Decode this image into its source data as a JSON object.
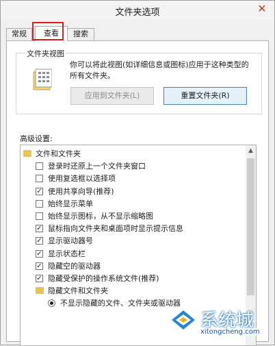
{
  "window": {
    "title": "文件夹选项",
    "close_symbol": "✕"
  },
  "tabs": [
    {
      "label": "常规",
      "selected": false
    },
    {
      "label": "查看",
      "selected": true
    },
    {
      "label": "搜索",
      "selected": false
    }
  ],
  "folder_view": {
    "group_label": "文件夹视图",
    "description": "你可以将此视图(如详细信息或图标)应用于这种类型的所有文件夹。",
    "apply_button": "应用到文件夹(L)",
    "reset_button": "重置文件夹(R)"
  },
  "advanced": {
    "label": "高级设置:",
    "items": [
      {
        "kind": "folder",
        "label": "文件和文件夹",
        "indent": 0
      },
      {
        "kind": "check",
        "label": "登录时还原上一个文件夹窗口",
        "checked": false,
        "indent": 1
      },
      {
        "kind": "check",
        "label": "使用复选框以选择项",
        "checked": false,
        "indent": 1
      },
      {
        "kind": "check",
        "label": "使用共享向导(推荐)",
        "checked": true,
        "indent": 1
      },
      {
        "kind": "check",
        "label": "始终显示菜单",
        "checked": false,
        "indent": 1
      },
      {
        "kind": "check",
        "label": "始终显示图标，从不显示缩略图",
        "checked": false,
        "indent": 1
      },
      {
        "kind": "check",
        "label": "鼠标指向文件夹和桌面项时显示提示信息",
        "checked": true,
        "indent": 1
      },
      {
        "kind": "check",
        "label": "显示驱动器号",
        "checked": true,
        "indent": 1
      },
      {
        "kind": "check",
        "label": "显示状态栏",
        "checked": true,
        "indent": 1
      },
      {
        "kind": "check",
        "label": "隐藏空的驱动器",
        "checked": true,
        "indent": 1
      },
      {
        "kind": "check",
        "label": "隐藏受保护的操作系统文件(推荐)",
        "checked": true,
        "indent": 1
      },
      {
        "kind": "folder",
        "label": "隐藏文件和文件夹",
        "indent": 1
      },
      {
        "kind": "radio",
        "label": "不显示隐藏的文件、文件夹或驱动器",
        "checked": true,
        "indent": 2
      }
    ]
  },
  "watermark": {
    "text": "系统城",
    "url": "xitongcheng.com"
  },
  "colors": {
    "highlight": "#e0191f",
    "accent": "#3c7fb1"
  }
}
